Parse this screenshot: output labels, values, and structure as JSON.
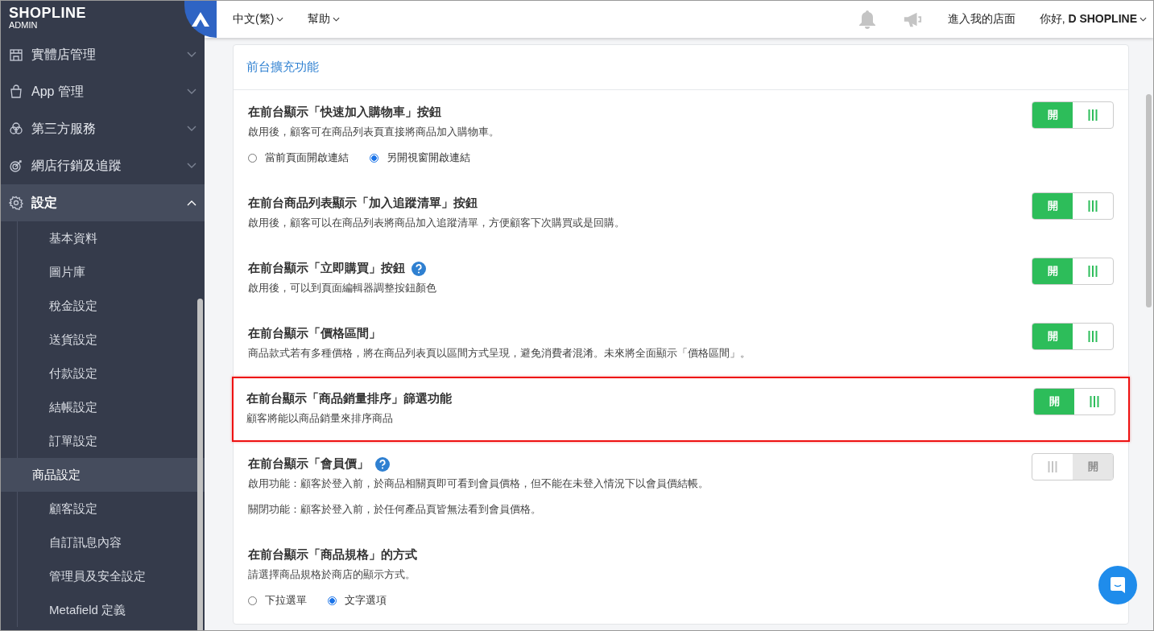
{
  "logo": {
    "brand": "SHOPLINE",
    "sub": "ADMIN"
  },
  "topbar": {
    "language": "中文(繁)",
    "help": "幫助",
    "store_link": "進入我的店面",
    "greeting": "你好, **D SHOPLINE**"
  },
  "sidebar": {
    "items": [
      {
        "label": "實體店管理",
        "expanded": false,
        "selected": false
      },
      {
        "label": "App 管理",
        "expanded": false,
        "selected": false
      },
      {
        "label": "第三方服務",
        "expanded": false,
        "selected": false
      },
      {
        "label": "網店行銷及追蹤",
        "expanded": false,
        "selected": false
      },
      {
        "label": "設定",
        "expanded": true,
        "selected": true,
        "children": [
          {
            "label": "基本資料",
            "selected": false
          },
          {
            "label": "圖片庫",
            "selected": false
          },
          {
            "label": "稅金設定",
            "selected": false
          },
          {
            "label": "送貨設定",
            "selected": false
          },
          {
            "label": "付款設定",
            "selected": false
          },
          {
            "label": "結帳設定",
            "selected": false
          },
          {
            "label": "訂單設定",
            "selected": false
          },
          {
            "label": "商品設定",
            "selected": true
          },
          {
            "label": "顧客設定",
            "selected": false
          },
          {
            "label": "自訂訊息內容",
            "selected": false
          },
          {
            "label": "管理員及安全設定",
            "selected": false
          },
          {
            "label": "Metafield 定義",
            "selected": false
          }
        ]
      }
    ]
  },
  "card": {
    "title": "前台擴充功能",
    "settings": [
      {
        "title": "在前台顯示「快速加入購物車」按鈕",
        "help": false,
        "highlighted": false,
        "descriptions": [
          "啟用後，顧客可在商品列表頁直接將商品加入購物車。"
        ],
        "toggle": {
          "label": "開",
          "on": true
        },
        "radios": [
          {
            "label": "當前頁面開啟連結",
            "selected": false
          },
          {
            "label": "另開視窗開啟連結",
            "selected": true
          }
        ]
      },
      {
        "title": "在前台商品列表顯示「加入追蹤清單」按鈕",
        "help": false,
        "highlighted": false,
        "descriptions": [
          "啟用後，顧客可以在商品列表將商品加入追蹤清單，方便顧客下次購買或是回購。"
        ],
        "toggle": {
          "label": "開",
          "on": true
        }
      },
      {
        "title": "在前台顯示「立即購買」按鈕",
        "help": true,
        "highlighted": false,
        "descriptions": [
          "啟用後，可以到頁面編輯器調整按鈕顏色"
        ],
        "toggle": {
          "label": "開",
          "on": true
        }
      },
      {
        "title": "在前台顯示「價格區間」",
        "help": false,
        "highlighted": false,
        "descriptions": [
          "商品款式若有多種價格，將在商品列表頁以區間方式呈現，避免消費者混淆。未來將全面顯示「價格區間」。"
        ],
        "toggle": {
          "label": "開",
          "on": true
        }
      },
      {
        "title": "在前台顯示「商品銷量排序」篩選功能",
        "help": false,
        "highlighted": true,
        "descriptions": [
          "顧客將能以商品銷量來排序商品"
        ],
        "toggle": {
          "label": "開",
          "on": true
        }
      },
      {
        "title": "在前台顯示「會員價」",
        "help": true,
        "highlighted": false,
        "descriptions": [
          "啟用功能：顧客於登入前，於商品相關頁即可看到會員價格，但不能在未登入情況下以會員價結帳。",
          "關閉功能：顧客於登入前，於任何產品頁皆無法看到會員價格。"
        ],
        "toggle": {
          "label": "開",
          "on": false
        }
      },
      {
        "title": "在前台顯示「商品規格」的方式",
        "help": false,
        "highlighted": false,
        "descriptions": [
          "請選擇商品規格於商店的顯示方式。"
        ],
        "radios": [
          {
            "label": "下拉選單",
            "selected": false
          },
          {
            "label": "文字選項",
            "selected": true
          }
        ]
      }
    ]
  }
}
